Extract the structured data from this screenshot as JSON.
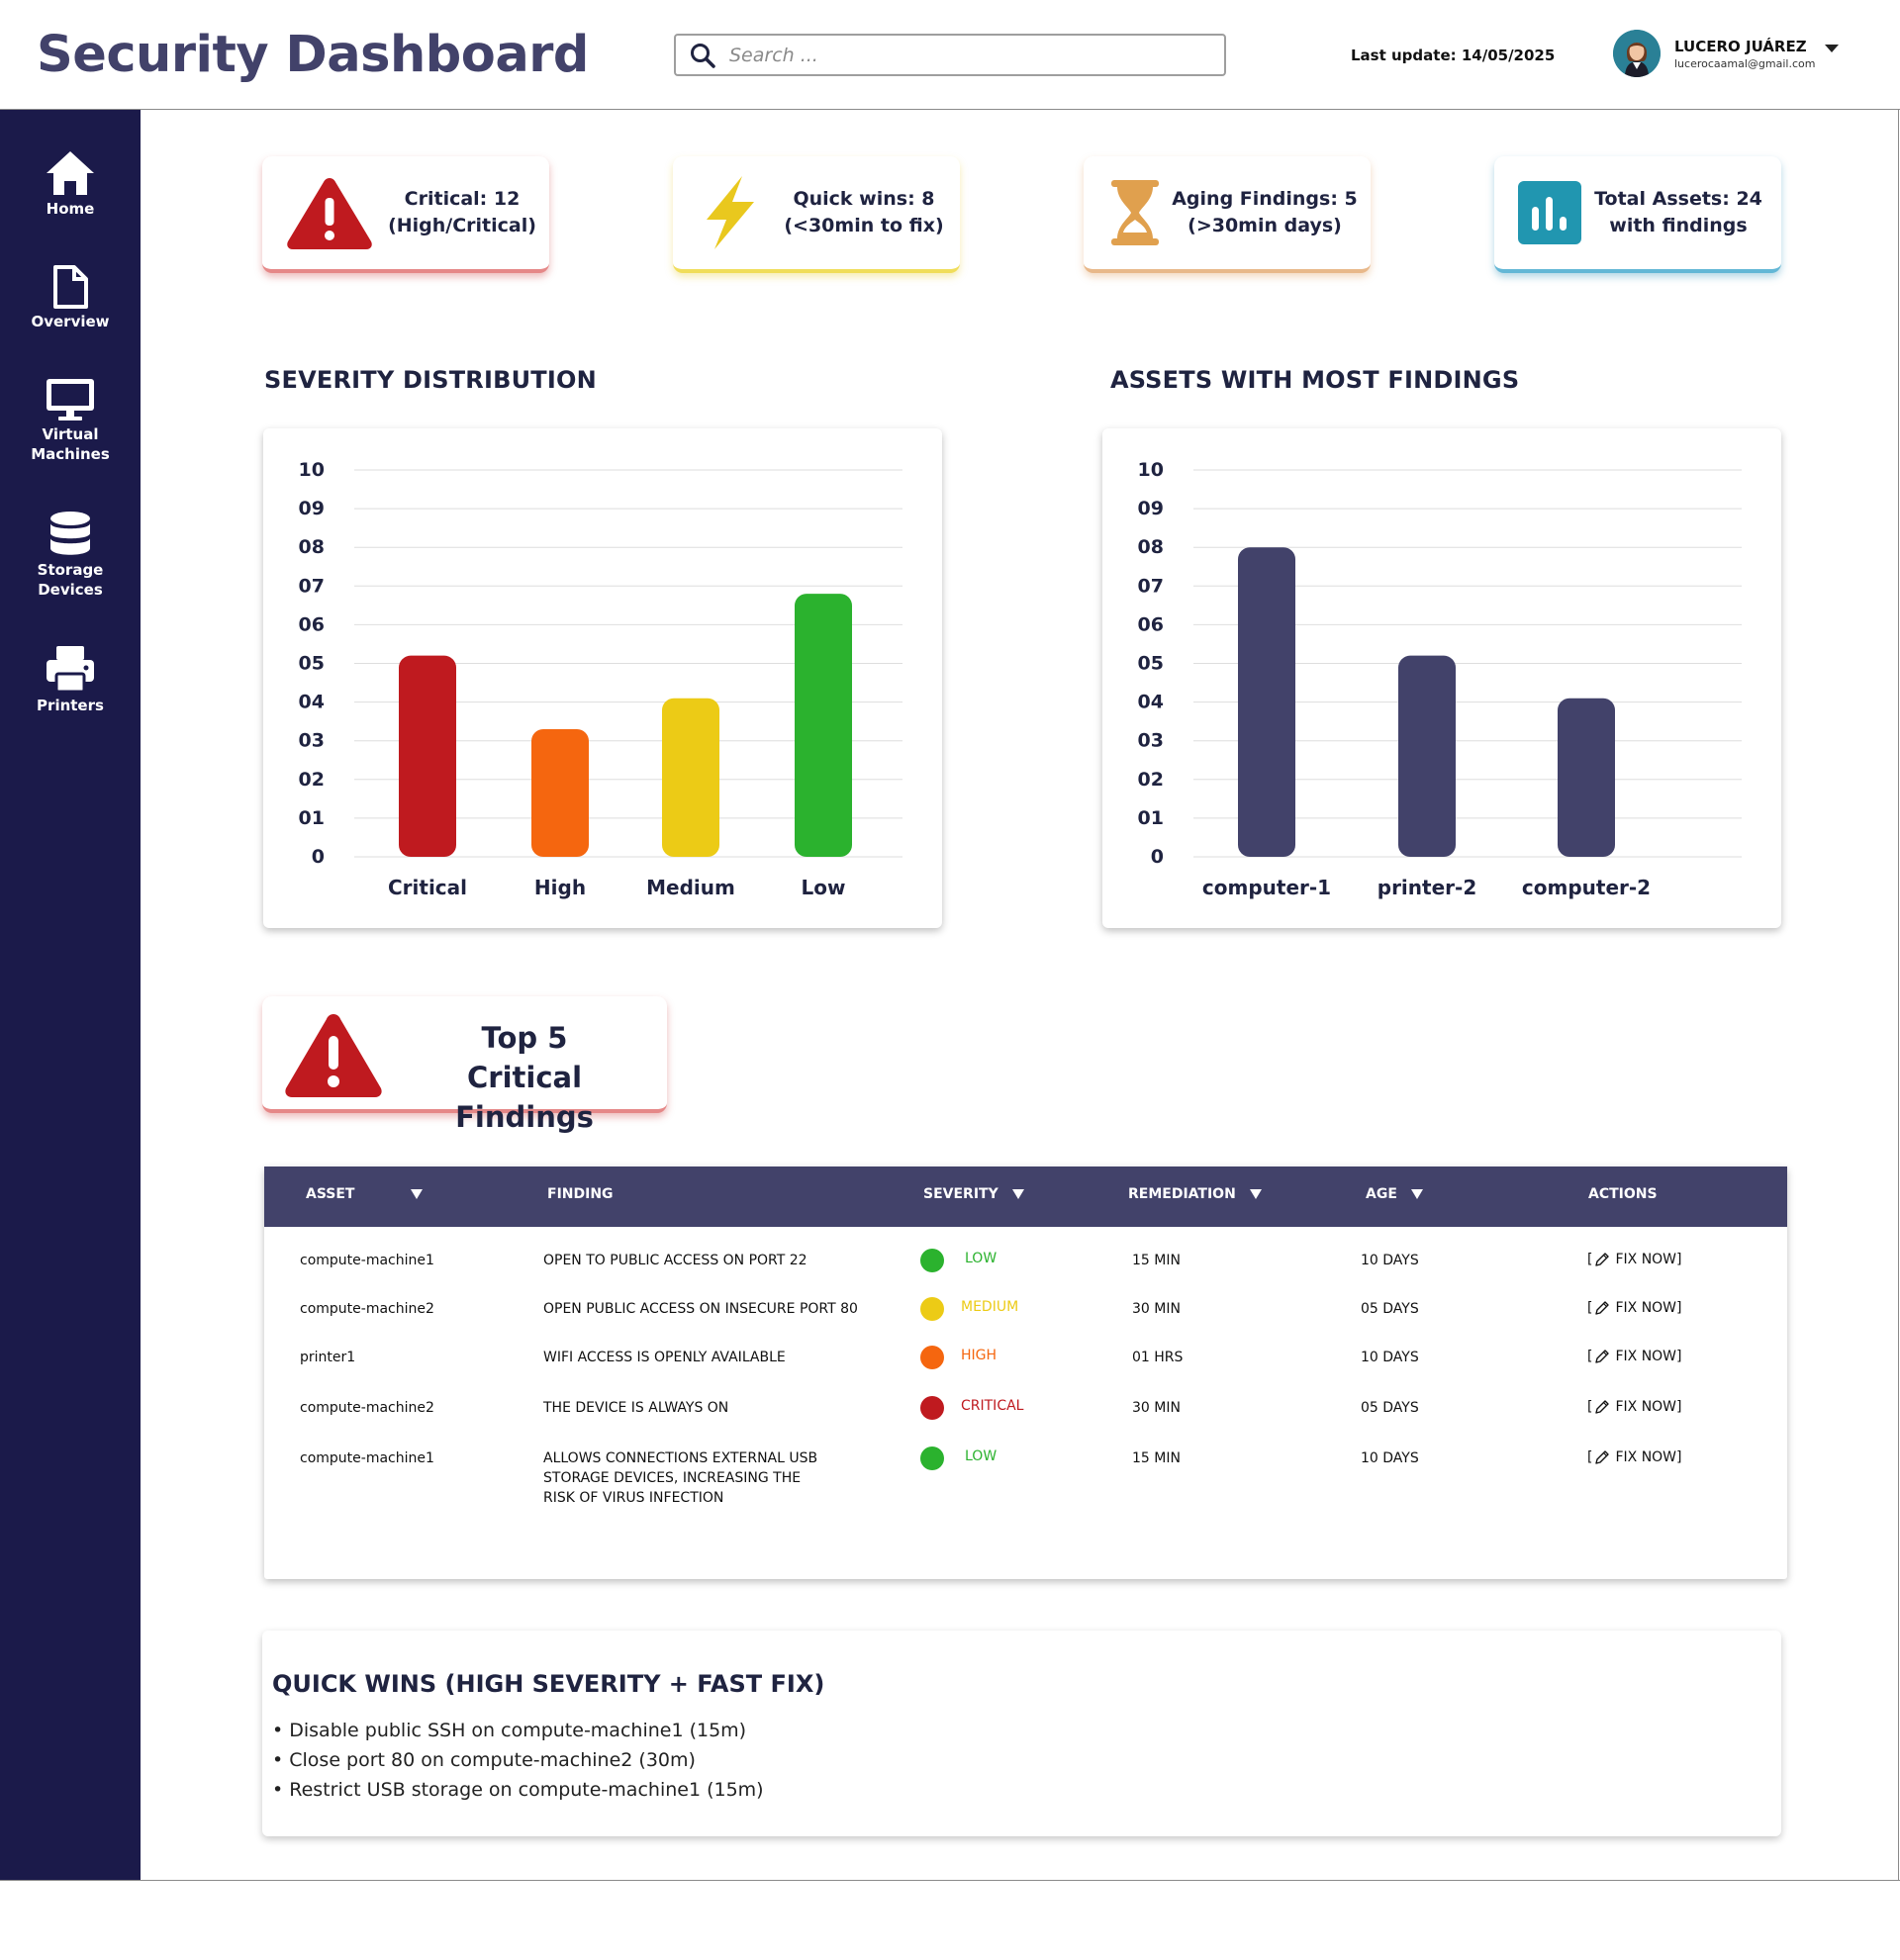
{
  "header": {
    "title": "Security Dashboard",
    "search_placeholder": "Search ...",
    "last_update": "Last update: 14/05/2025",
    "user_name": "LUCERO JUÁREZ",
    "user_email": "lucerocaamal@gmail.com"
  },
  "sidebar": {
    "items": [
      {
        "label_line1": "Home",
        "label_line2": "",
        "icon": "home-icon"
      },
      {
        "label_line1": "Overview",
        "label_line2": "",
        "icon": "document-icon"
      },
      {
        "label_line1": "Virtual",
        "label_line2": "Machines",
        "icon": "monitor-icon"
      },
      {
        "label_line1": "Storage",
        "label_line2": "Devices",
        "icon": "database-icon"
      },
      {
        "label_line1": "Printers",
        "label_line2": "",
        "icon": "printer-icon"
      }
    ]
  },
  "kpis": {
    "critical": {
      "line1": "Critical: 12",
      "line2": "(High/Critical)",
      "icon": "warning-icon",
      "color": "#bf1a1f"
    },
    "quick": {
      "line1": "Quick wins: 8",
      "line2": "(<30min to fix)",
      "icon": "lightning-icon",
      "color": "#e9c81e"
    },
    "aging": {
      "line1": "Aging Findings: 5",
      "line2": "(>30min days)",
      "icon": "hourglass-icon",
      "color": "#e0a04e"
    },
    "assets": {
      "line1": "Total Assets: 24",
      "line2": "with findings",
      "icon": "bar-chart-icon",
      "color": "#2196b0"
    }
  },
  "sections": {
    "severity_title": "SEVERITY DISTRIBUTION",
    "assets_title": "ASSETS WITH MOST FINDINGS",
    "top5_line1": "Top 5",
    "top5_line2": "Critical Findings",
    "quickwins_title": "QUICK WINS (HIGH SEVERITY + FAST FIX)"
  },
  "chart_data": [
    {
      "type": "bar",
      "title": "SEVERITY DISTRIBUTION",
      "categories": [
        "Critical",
        "High",
        "Medium",
        "Low"
      ],
      "values": [
        5.2,
        3.3,
        4.1,
        6.8
      ],
      "colors": [
        "#bf1a1f",
        "#f5660f",
        "#eccb16",
        "#2bb22e"
      ],
      "ylim": [
        0,
        10
      ],
      "yticks": [
        "0",
        "01",
        "02",
        "03",
        "04",
        "05",
        "06",
        "07",
        "08",
        "09",
        "10"
      ],
      "grid": true
    },
    {
      "type": "bar",
      "title": "ASSETS WITH MOST FINDINGS",
      "categories": [
        "computer-1",
        "printer-2",
        "computer-2"
      ],
      "values": [
        8.0,
        5.2,
        4.1
      ],
      "colors": [
        "#42426a",
        "#42426a",
        "#42426a"
      ],
      "ylim": [
        0,
        10
      ],
      "yticks": [
        "0",
        "01",
        "02",
        "03",
        "04",
        "05",
        "06",
        "07",
        "08",
        "09",
        "10"
      ],
      "grid": true
    }
  ],
  "table": {
    "columns": [
      "ASSET",
      "FINDING",
      "SEVERITY",
      "REMEDIATION",
      "AGE",
      "ACTIONS"
    ],
    "rows": [
      {
        "asset": "compute-machine1",
        "finding": [
          "OPEN TO PUBLIC ACCESS ON PORT 22"
        ],
        "severity": "LOW",
        "severity_color": "#2bb22e",
        "remediation": "15 MIN",
        "age": "10 DAYS",
        "action": "FIX NOW]"
      },
      {
        "asset": "compute-machine2",
        "finding": [
          "OPEN PUBLIC ACCESS ON INSECURE PORT 80"
        ],
        "severity": "MEDIUM",
        "severity_color": "#eccb16",
        "remediation": "30 MIN",
        "age": "05 DAYS",
        "action": "FIX NOW]"
      },
      {
        "asset": "printer1",
        "finding": [
          "WIFI ACCESS IS OPENLY AVAILABLE"
        ],
        "severity": "HIGH",
        "severity_color": "#f5660f",
        "remediation": "01 HRS",
        "age": "10 DAYS",
        "action": "FIX NOW]"
      },
      {
        "asset": "compute-machine2",
        "finding": [
          "THE DEVICE IS ALWAYS ON"
        ],
        "severity": "CRITICAL",
        "severity_color": "#bf1a1f",
        "remediation": "30 MIN",
        "age": "05 DAYS",
        "action": "FIX NOW]"
      },
      {
        "asset": "compute-machine1",
        "finding": [
          "ALLOWS CONNECTIONS EXTERNAL USB",
          "STORAGE DEVICES, INCREASING THE",
          "RISK OF VIRUS INFECTION"
        ],
        "severity": "LOW",
        "severity_color": "#2bb22e",
        "remediation": "15 MIN",
        "age": "10 DAYS",
        "action": "FIX NOW]"
      }
    ]
  },
  "quick_wins": [
    "• Disable public SSH on compute-machine1 (15m)",
    "• Close port 80 on compute-machine2 (30m)",
    "• Restrict USB storage on compute-machine1 (15m)"
  ],
  "colors": {
    "sidebar": "#1b1a4a",
    "accent": "#42426a"
  }
}
